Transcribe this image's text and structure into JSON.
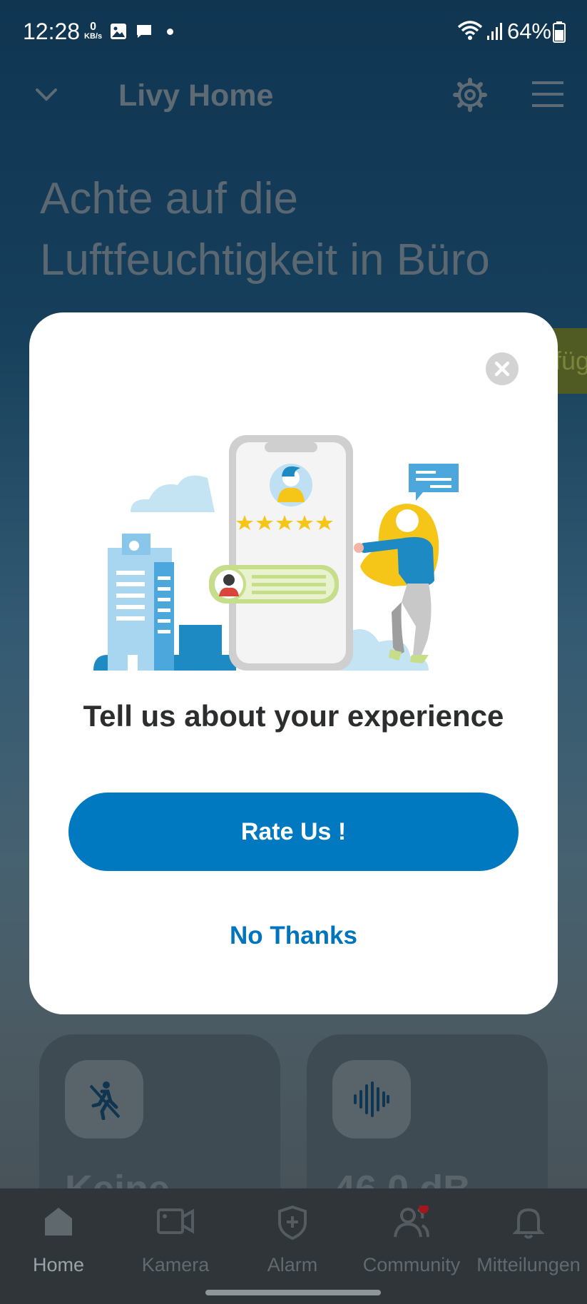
{
  "status_bar": {
    "time": "12:28",
    "kbs_value": "0",
    "kbs_unit": "KB/s",
    "battery": "64%"
  },
  "app_bar": {
    "title": "Livy Home"
  },
  "headline": "Achte auf die Luftfeuchtigkeit in Büro",
  "side_tab_text": "füg",
  "cards": [
    {
      "text": "Keine",
      "icon": "no-motion-icon"
    },
    {
      "text": "46,0 dB",
      "icon": "sound-wave-icon"
    }
  ],
  "modal": {
    "title": "Tell us about your experience",
    "rate_button": "Rate Us !",
    "dismiss": "No Thanks"
  },
  "bottom_nav": [
    {
      "label": "Home",
      "icon": "home-icon",
      "active": true
    },
    {
      "label": "Kamera",
      "icon": "camera-icon",
      "active": false
    },
    {
      "label": "Alarm",
      "icon": "shield-icon",
      "active": false
    },
    {
      "label": "Community",
      "icon": "community-icon",
      "active": false
    },
    {
      "label": "Mitteilungen",
      "icon": "bell-icon",
      "active": false
    }
  ],
  "colors": {
    "primary": "#0079c1",
    "link": "#0075bd",
    "accent_yellow": "#f5c518"
  }
}
